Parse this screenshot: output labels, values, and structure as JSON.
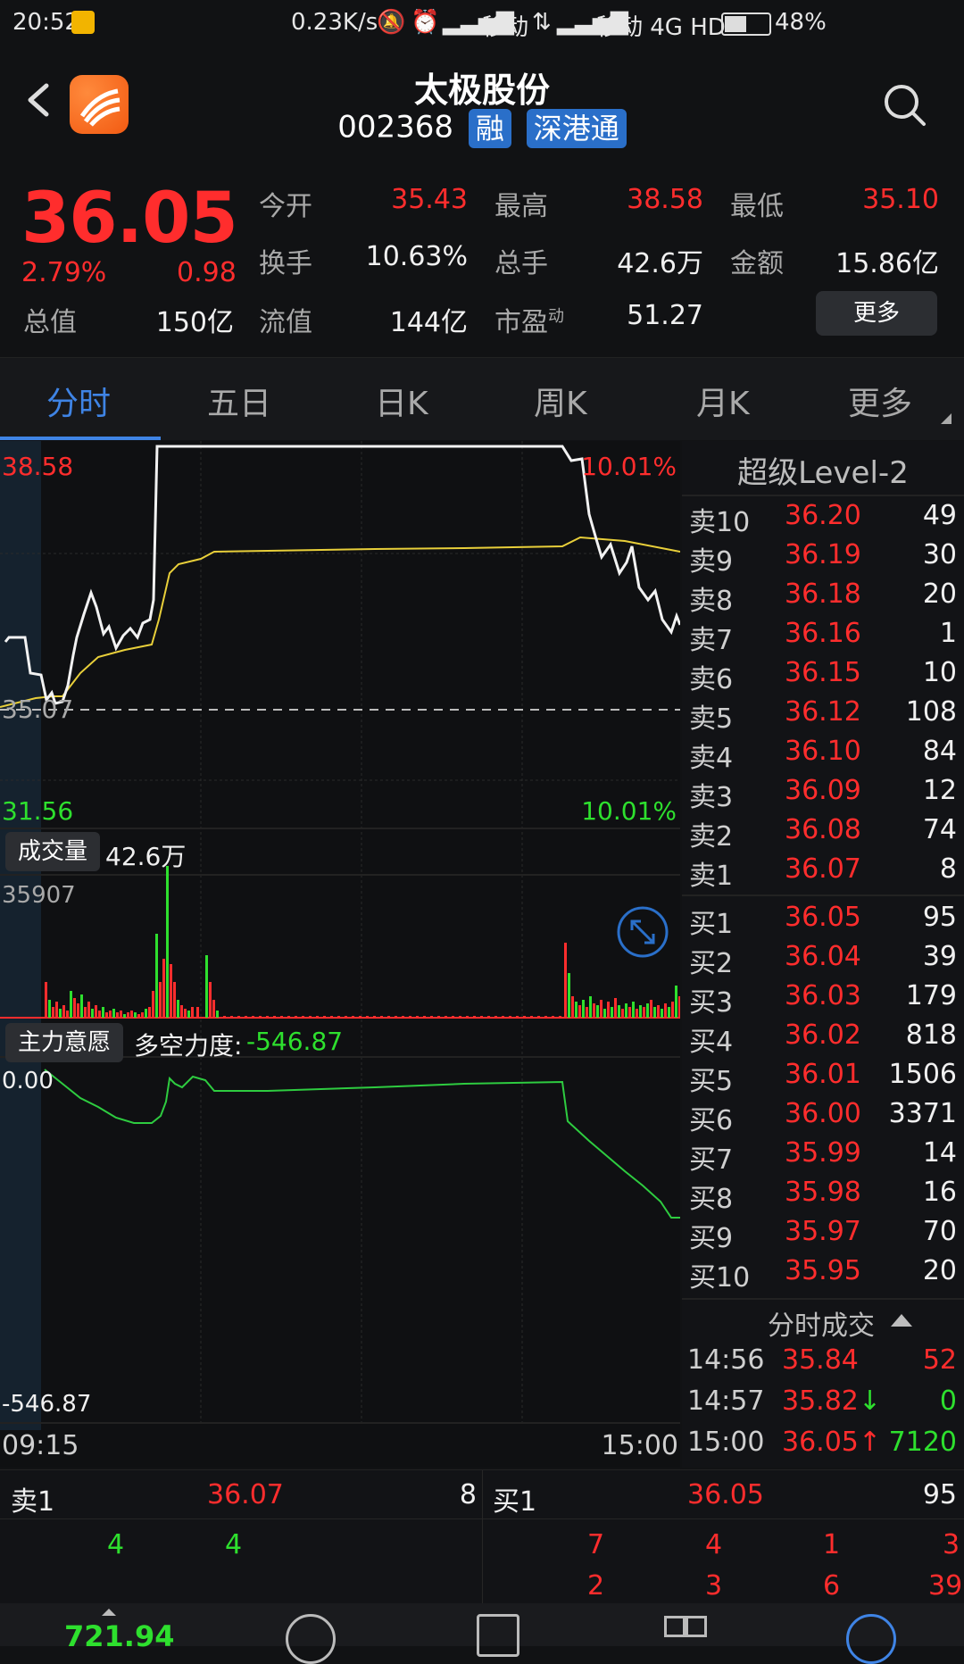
{
  "status_bar": {
    "time": "20:52",
    "speed": "0.23K/s",
    "carrier1": "移动",
    "carrier2": "移动 4G HD",
    "battery": "48%"
  },
  "header": {
    "title": "太极股份",
    "code": "002368",
    "badge1": "融",
    "badge2": "深港通"
  },
  "quote": {
    "price": "36.05",
    "pct": "2.79%",
    "change": "0.98",
    "open_label": "今开",
    "open": "35.43",
    "high_label": "最高",
    "high": "38.58",
    "low_label": "最低",
    "low": "35.10",
    "turnover_label": "换手",
    "turnover": "10.63%",
    "volume_label": "总手",
    "volume": "42.6万",
    "amount_label": "金额",
    "amount": "15.86亿",
    "mcap_label": "总值",
    "mcap": "150亿",
    "float_label": "流值",
    "float": "144亿",
    "pe_label": "市盈",
    "pe_sup": "动",
    "pe": "51.27",
    "more": "更多"
  },
  "tabs": [
    "分时",
    "五日",
    "日K",
    "周K",
    "月K",
    "更多"
  ],
  "chart": {
    "top_price": "38.58",
    "top_pct": "10.01%",
    "mid_price": "35.07",
    "bottom_price": "31.56",
    "bottom_pct": "10.01%",
    "volume_tag": "成交量",
    "volume_total": "42.6万",
    "volume_max": "35907",
    "zl_tag": "主力意愿",
    "force_label": "多空力度:",
    "force_value": "-546.87",
    "zl_top": "0.00",
    "zl_bottom": "-546.87",
    "x_start": "09:15",
    "x_end": "15:00"
  },
  "book": {
    "title": "超级Level-2",
    "asks": [
      {
        "label": "卖10",
        "price": "36.20",
        "qty": "49"
      },
      {
        "label": "卖9",
        "price": "36.19",
        "qty": "30"
      },
      {
        "label": "卖8",
        "price": "36.18",
        "qty": "20"
      },
      {
        "label": "卖7",
        "price": "36.16",
        "qty": "1"
      },
      {
        "label": "卖6",
        "price": "36.15",
        "qty": "10"
      },
      {
        "label": "卖5",
        "price": "36.12",
        "qty": "108"
      },
      {
        "label": "卖4",
        "price": "36.10",
        "qty": "84"
      },
      {
        "label": "卖3",
        "price": "36.09",
        "qty": "12"
      },
      {
        "label": "卖2",
        "price": "36.08",
        "qty": "74"
      },
      {
        "label": "卖1",
        "price": "36.07",
        "qty": "8"
      }
    ],
    "bids": [
      {
        "label": "买1",
        "price": "36.05",
        "qty": "95"
      },
      {
        "label": "买2",
        "price": "36.04",
        "qty": "39"
      },
      {
        "label": "买3",
        "price": "36.03",
        "qty": "179"
      },
      {
        "label": "买4",
        "price": "36.02",
        "qty": "818"
      },
      {
        "label": "买5",
        "price": "36.01",
        "qty": "1506"
      },
      {
        "label": "买6",
        "price": "36.00",
        "qty": "3371"
      },
      {
        "label": "买7",
        "price": "35.99",
        "qty": "14"
      },
      {
        "label": "买8",
        "price": "35.98",
        "qty": "16"
      },
      {
        "label": "买9",
        "price": "35.97",
        "qty": "70"
      },
      {
        "label": "买10",
        "price": "35.95",
        "qty": "20"
      }
    ],
    "trades_title": "分时成交",
    "trades": [
      {
        "time": "14:56",
        "price": "35.84",
        "vol": "52",
        "arrow": ""
      },
      {
        "time": "14:57",
        "price": "35.82",
        "vol": "0",
        "arrow": "↓"
      },
      {
        "time": "15:00",
        "price": "36.05",
        "vol": "7120",
        "arrow": "↑"
      }
    ]
  },
  "queue": {
    "sell_label": "卖1",
    "sell_price": "36.07",
    "sell_qty": "8",
    "buy_label": "买1",
    "buy_price": "36.05",
    "buy_qty": "95",
    "sell_orders": [
      "4",
      "4"
    ],
    "buy_orders_row1": [
      "7",
      "4",
      "1",
      "3"
    ],
    "buy_orders_row2": [
      "2",
      "3",
      "6",
      "39"
    ]
  },
  "nav": {
    "index_value": "721.94"
  }
}
